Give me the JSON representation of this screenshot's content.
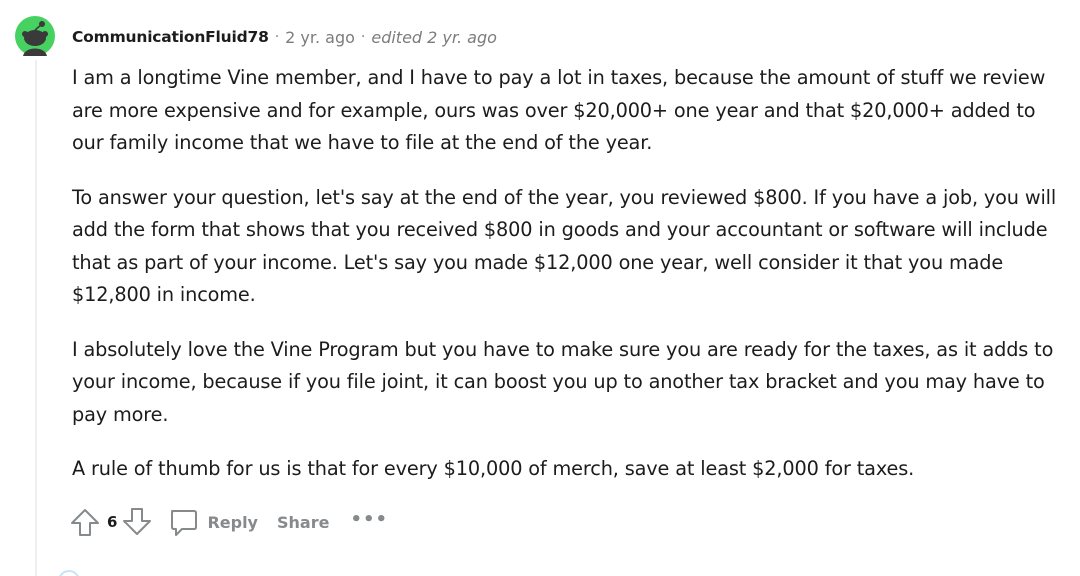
{
  "comment": {
    "username": "CommunicationFluid78",
    "separator": "·",
    "time_ago": "2 yr. ago",
    "edited": "edited 2 yr. ago",
    "paragraphs": [
      "I am a longtime Vine member, and I have to pay a lot in taxes, because the amount of stuff we review are more expensive and for example, ours was over $20,000+ one year and that $20,000+ added to our family income that we have to file at the end of the year.",
      "To answer your question, let's say at the end of the year, you reviewed $800. If you have a job, you will add the form that shows that you received $800 in goods and your accountant or software will include that as part of your income. Let's say you made $12,000 one year, well consider it that you made $12,800 in income.",
      "I absolutely love the Vine Program but you have to make sure you are ready for the taxes, as it adds to your income, because if you file joint, it can boost you up to another tax bracket and you may have to pay more.",
      "A rule of thumb for us is that for every $10,000 of merch, save at least $2,000 for taxes."
    ],
    "avatar_color": "#46d160",
    "avatar_bg": "#edeff1"
  },
  "actions": {
    "upvote_icon": "arrow-up-outline-icon",
    "score": "6",
    "downvote_icon": "arrow-down-outline-icon",
    "reply_icon": "speech-bubble-icon",
    "reply_label": "Reply",
    "share_label": "Share",
    "more_label": "•••"
  },
  "colors": {
    "text": "#1c1c1c",
    "meta": "#7c7c7c",
    "action": "#878a8c",
    "thread_line": "#edeff1"
  }
}
